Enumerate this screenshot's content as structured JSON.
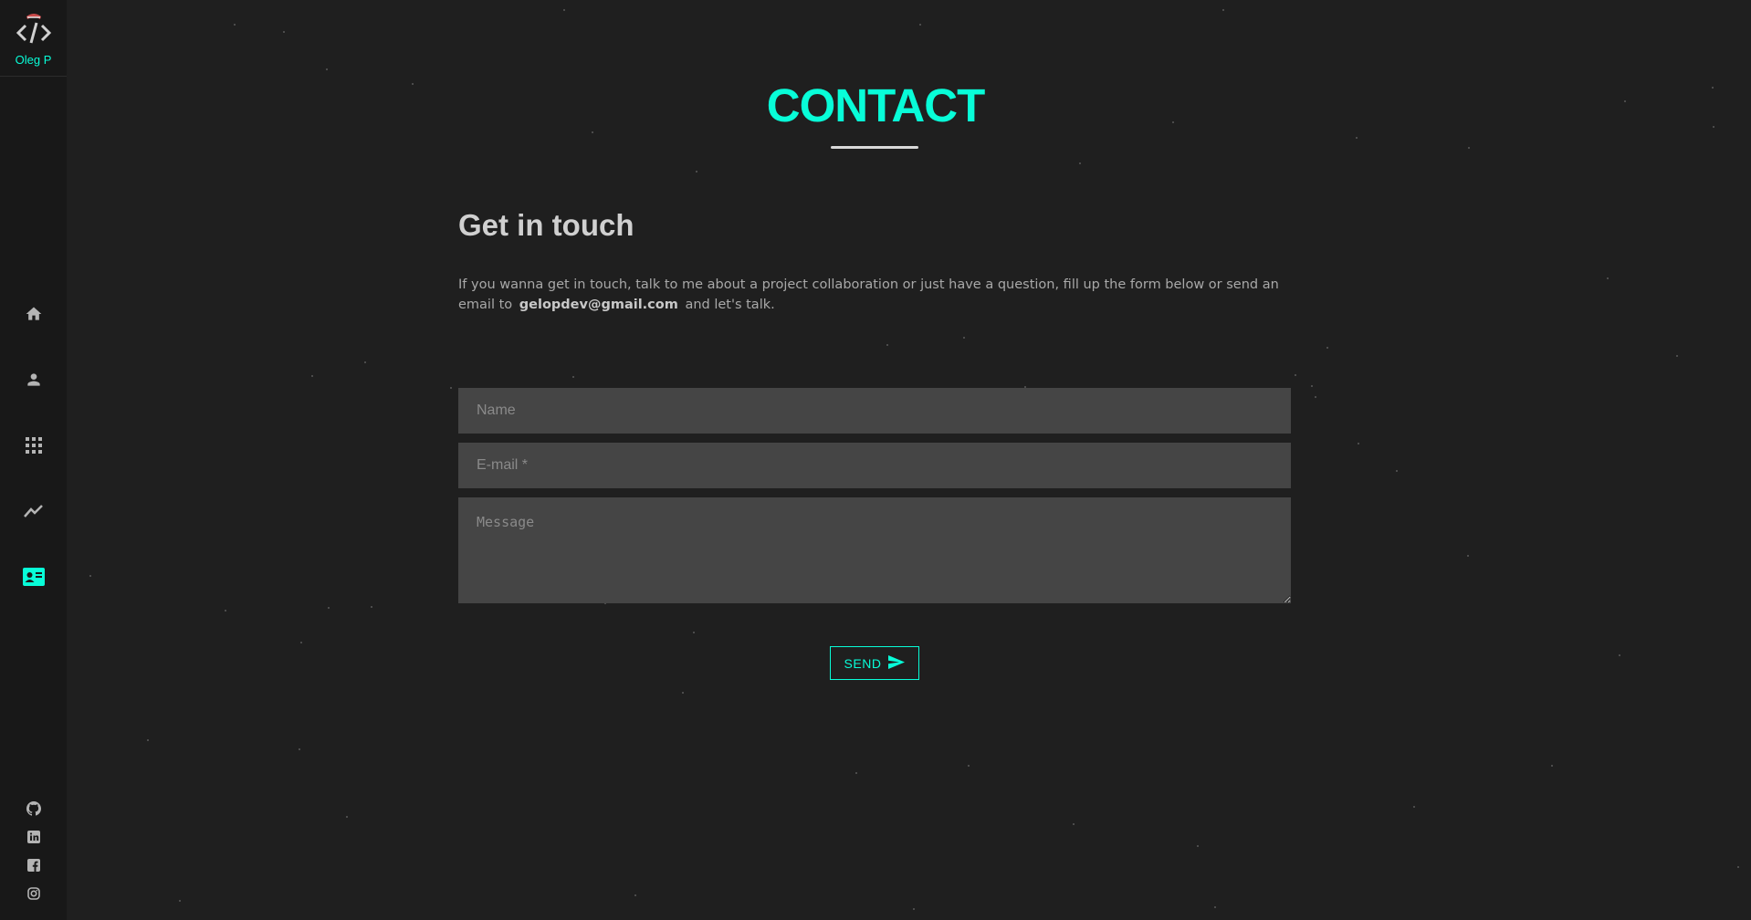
{
  "brand": {
    "name": "Oleg P",
    "accent_color": "#08fdd8",
    "logo_icon": "code-brackets-icon"
  },
  "nav": {
    "items": [
      {
        "icon": "home-icon",
        "active": false
      },
      {
        "icon": "user-icon",
        "active": false
      },
      {
        "icon": "grid-icon",
        "active": false
      },
      {
        "icon": "trending-icon",
        "active": false
      },
      {
        "icon": "contact-card-icon",
        "active": true
      }
    ]
  },
  "social": {
    "items": [
      {
        "icon": "github-icon"
      },
      {
        "icon": "linkedin-icon"
      },
      {
        "icon": "facebook-icon"
      },
      {
        "icon": "instagram-icon"
      }
    ]
  },
  "page": {
    "title": "CONTACT",
    "subtitle": "Get in touch",
    "intro_before": "If you wanna get in touch, talk to me about a project collaboration or just have a question, fill up the form below or send an email to",
    "email": "gelopdev@gmail.com",
    "intro_after": "and let's talk."
  },
  "form": {
    "name_placeholder": "Name",
    "email_placeholder": "E-mail *",
    "message_placeholder": "Message",
    "name_value": "",
    "email_value": "",
    "message_value": "",
    "send_label": "SEND"
  }
}
